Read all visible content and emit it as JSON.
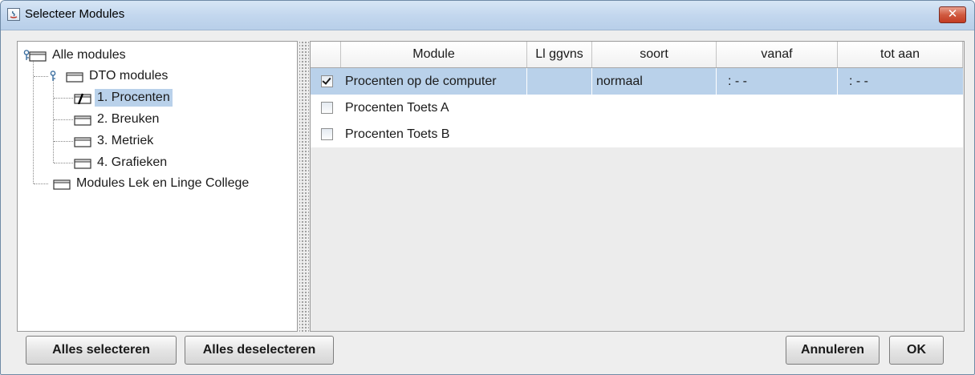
{
  "window": {
    "title": "Selecteer Modules",
    "close_label": "✕"
  },
  "tree": {
    "root": "Alle modules",
    "dto": "DTO modules",
    "items": [
      "1. Procenten",
      "2. Breuken",
      "3. Metriek",
      "4. Grafieken"
    ],
    "lek": "Modules Lek en Linge College",
    "selected_index": 0
  },
  "table": {
    "headers": [
      "Module",
      "Ll ggvns",
      "soort",
      "vanaf",
      "tot aan"
    ],
    "rows": [
      {
        "checked": true,
        "module": "Procenten op de computer",
        "ll": "",
        "soort": "normaal",
        "vanaf": ":  -  -",
        "tot_aan": ":  -  -"
      },
      {
        "checked": false,
        "module": "Procenten Toets A",
        "ll": "",
        "soort": "",
        "vanaf": "",
        "tot_aan": ""
      },
      {
        "checked": false,
        "module": "Procenten Toets B",
        "ll": "",
        "soort": "",
        "vanaf": "",
        "tot_aan": ""
      }
    ]
  },
  "buttons": {
    "select_all": "Alles selecteren",
    "deselect_all": "Alles deselecteren",
    "cancel": "Annuleren",
    "ok": "OK"
  },
  "colors": {
    "selection": "#b9d1ea",
    "titlebar": "#c3d7ee",
    "close": "#c33b22"
  }
}
